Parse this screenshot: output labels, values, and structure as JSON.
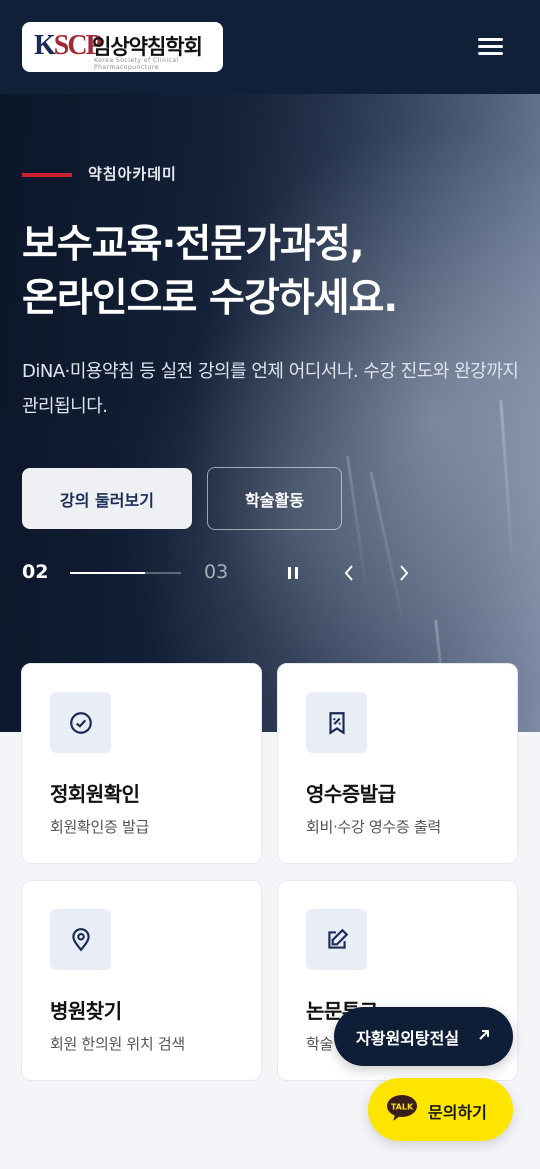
{
  "header": {
    "logo_mark": "KSCP",
    "logo_name": "임상약침학회",
    "logo_tagline": "Korea Society of Clinical Pharmacopuncture",
    "menu_icon": "hamburger-icon"
  },
  "hero": {
    "eyebrow": "약침아카데미",
    "headline_line1": "보수교육·전문가과정,",
    "headline_line2": "온라인으로 수강하세요.",
    "subtitle": "DiNA·미용약침 등 실전 강의를 언제 어디서나. 수강 진도와 완강까지 관리됩니다.",
    "primary_button": "강의 둘러보기",
    "secondary_button": "학술활동",
    "slider": {
      "current": "02",
      "next": "03",
      "progress": 0.68,
      "pause_icon": "pause-icon",
      "prev_icon": "chevron-left-icon",
      "next_icon": "chevron-right-icon"
    }
  },
  "cards": [
    {
      "title": "정회원확인",
      "desc": "회원확인증 발급",
      "icon": "check-circle-icon"
    },
    {
      "title": "영수증발급",
      "desc": "회비·수강 영수증 출력",
      "icon": "receipt-icon"
    },
    {
      "title": "병원찾기",
      "desc": "회원 한의원 위치 검색",
      "icon": "map-pin-icon"
    },
    {
      "title": "논문투고",
      "desc": "학술",
      "icon": "edit-icon"
    }
  ],
  "floating": {
    "tour_label": "자황원외탕전실",
    "tour_icon": "arrow-up-right-icon",
    "kakao_badge": "TALK",
    "kakao_label": "문의하기"
  },
  "colors": {
    "navy": "#102038",
    "accent_red": "#c8202f",
    "kakao_yellow": "#fde500",
    "icon_bg": "#e9eef6",
    "icon_color": "#1a2b55"
  }
}
